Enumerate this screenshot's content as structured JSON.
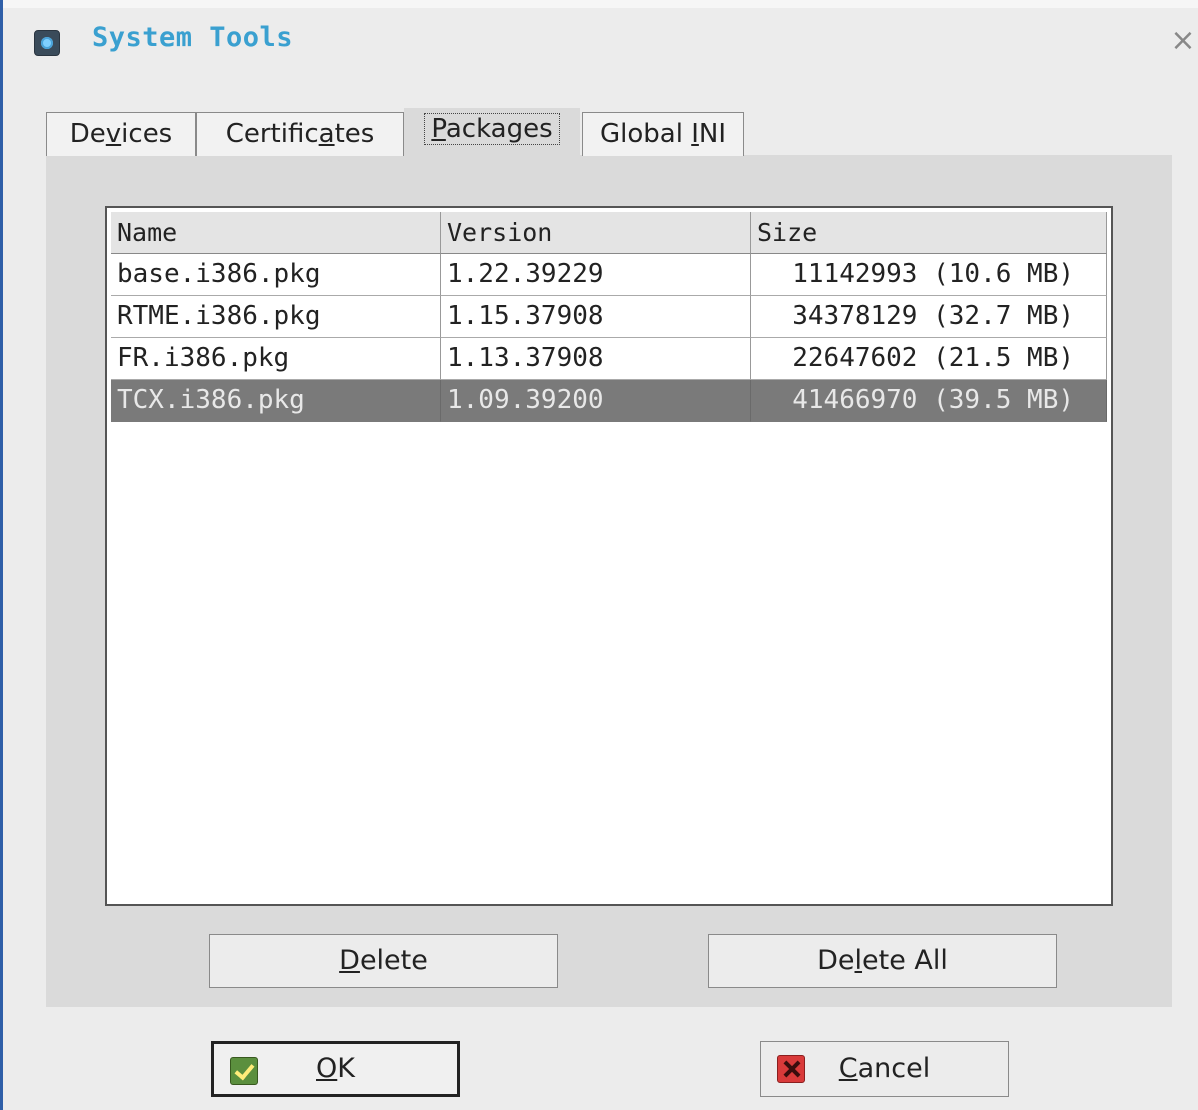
{
  "window": {
    "title": "System Tools",
    "close_label": "×"
  },
  "tabs": [
    {
      "pre": "De",
      "key": "v",
      "post": "ices",
      "active": false
    },
    {
      "pre": "Certific",
      "key": "a",
      "post": "tes",
      "active": false
    },
    {
      "pre": "",
      "key": "P",
      "post": "ackages",
      "active": true
    },
    {
      "pre": "Global ",
      "key": "I",
      "post": "NI",
      "active": false
    }
  ],
  "table": {
    "columns": [
      "Name",
      "Version",
      "Size"
    ],
    "rows": [
      {
        "name": "base.i386.pkg",
        "version": "1.22.39229",
        "size": "11142993 (10.6 MB)",
        "selected": false
      },
      {
        "name": "RTME.i386.pkg",
        "version": "1.15.37908",
        "size": "34378129 (32.7 MB)",
        "selected": false
      },
      {
        "name": "FR.i386.pkg",
        "version": "1.13.37908",
        "size": "22647602 (21.5 MB)",
        "selected": false
      },
      {
        "name": "TCX.i386.pkg",
        "version": "1.09.39200",
        "size": "41466970 (39.5 MB)",
        "selected": true
      }
    ]
  },
  "buttons": {
    "delete": {
      "pre": "",
      "key": "D",
      "post": "elete"
    },
    "delete_all": {
      "pre": "De",
      "key": "l",
      "post": "ete All"
    },
    "ok": {
      "pre": "",
      "key": "O",
      "post": "K"
    },
    "cancel": {
      "pre": "",
      "key": "C",
      "post": "ancel"
    }
  },
  "icons": {
    "app": "system-tools-gear-icon",
    "ok": "green-check-icon",
    "cancel": "red-x-icon"
  },
  "colors": {
    "title": "#3aa0d0",
    "selected_row": "#7a7a7a",
    "window_border": "#2f5fa8"
  }
}
